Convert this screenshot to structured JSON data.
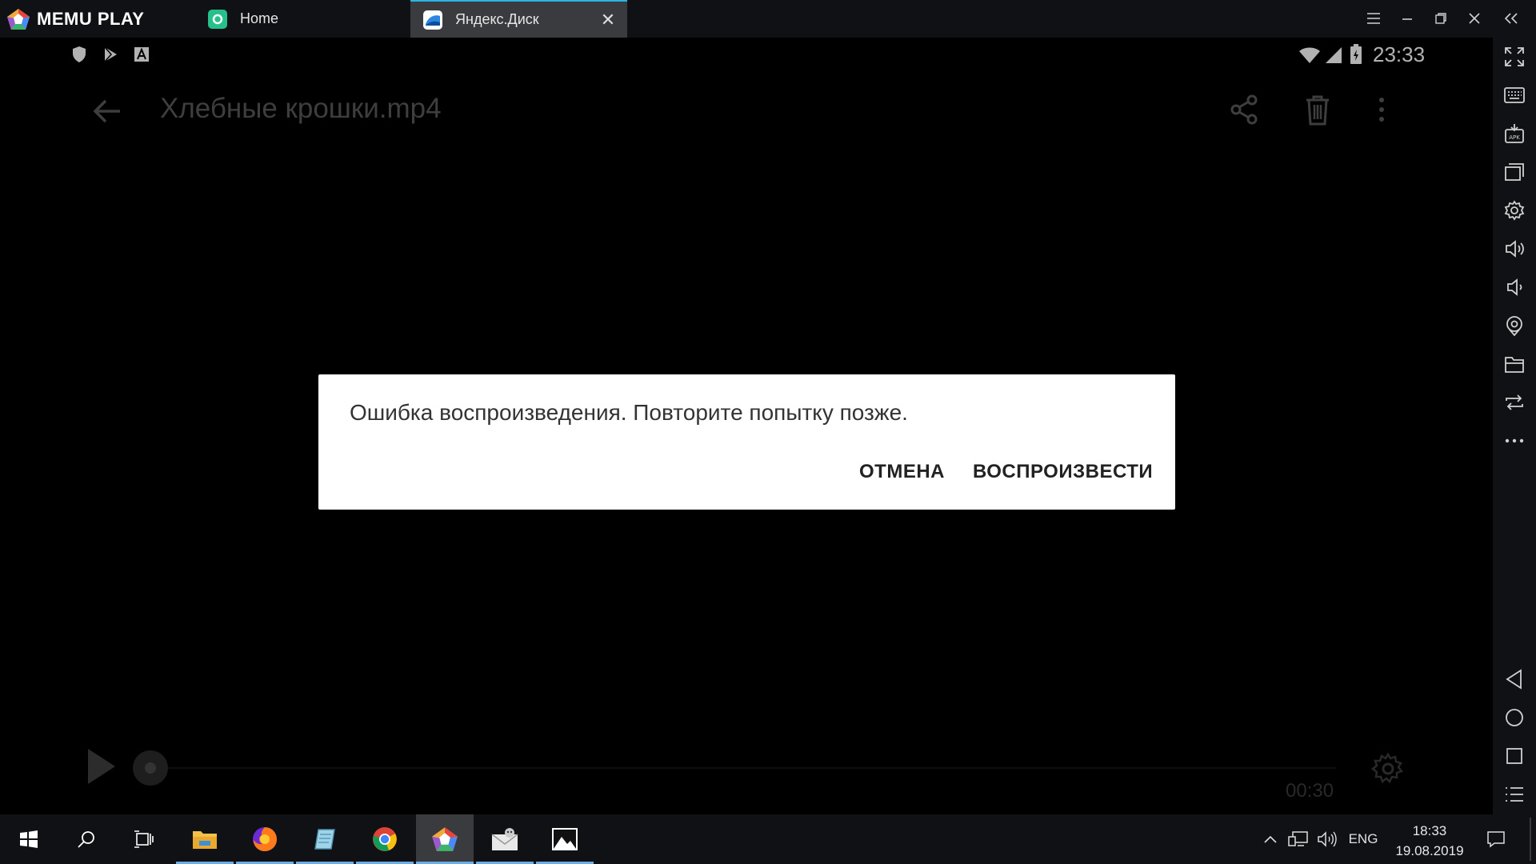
{
  "emulator": {
    "app_name": "MEMU PLAY",
    "tabs": [
      {
        "label": "Home",
        "active": false
      },
      {
        "label": "Яндекс.Диск",
        "active": true
      }
    ]
  },
  "status_bar": {
    "time": "23:33"
  },
  "app_bar": {
    "title": "Хлебные крошки.mp4"
  },
  "dialog": {
    "message": "Ошибка воспроизведения. Повторите попытку позже.",
    "cancel_label": "ОТМЕНА",
    "play_label": "ВОСПРОИЗВЕСТИ"
  },
  "player": {
    "duration": "00:30",
    "progress": 0
  },
  "taskbar": {
    "language": "ENG",
    "time": "18:33",
    "date": "19.08.2019"
  },
  "colors": {
    "emulator_chrome": "#101114",
    "active_tab": "#3a3b3f",
    "accent": "#2bb3e6",
    "dialog_bg": "#ffffff"
  }
}
